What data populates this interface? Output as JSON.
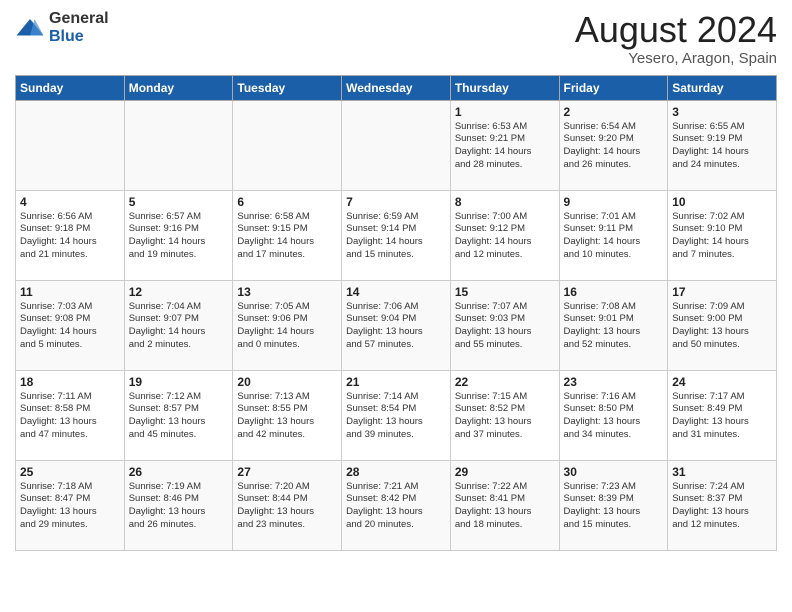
{
  "logo": {
    "general": "General",
    "blue": "Blue"
  },
  "title": "August 2024",
  "subtitle": "Yesero, Aragon, Spain",
  "days_of_week": [
    "Sunday",
    "Monday",
    "Tuesday",
    "Wednesday",
    "Thursday",
    "Friday",
    "Saturday"
  ],
  "weeks": [
    [
      {
        "day": "",
        "info": ""
      },
      {
        "day": "",
        "info": ""
      },
      {
        "day": "",
        "info": ""
      },
      {
        "day": "",
        "info": ""
      },
      {
        "day": "1",
        "info": "Sunrise: 6:53 AM\nSunset: 9:21 PM\nDaylight: 14 hours\nand 28 minutes."
      },
      {
        "day": "2",
        "info": "Sunrise: 6:54 AM\nSunset: 9:20 PM\nDaylight: 14 hours\nand 26 minutes."
      },
      {
        "day": "3",
        "info": "Sunrise: 6:55 AM\nSunset: 9:19 PM\nDaylight: 14 hours\nand 24 minutes."
      }
    ],
    [
      {
        "day": "4",
        "info": "Sunrise: 6:56 AM\nSunset: 9:18 PM\nDaylight: 14 hours\nand 21 minutes."
      },
      {
        "day": "5",
        "info": "Sunrise: 6:57 AM\nSunset: 9:16 PM\nDaylight: 14 hours\nand 19 minutes."
      },
      {
        "day": "6",
        "info": "Sunrise: 6:58 AM\nSunset: 9:15 PM\nDaylight: 14 hours\nand 17 minutes."
      },
      {
        "day": "7",
        "info": "Sunrise: 6:59 AM\nSunset: 9:14 PM\nDaylight: 14 hours\nand 15 minutes."
      },
      {
        "day": "8",
        "info": "Sunrise: 7:00 AM\nSunset: 9:12 PM\nDaylight: 14 hours\nand 12 minutes."
      },
      {
        "day": "9",
        "info": "Sunrise: 7:01 AM\nSunset: 9:11 PM\nDaylight: 14 hours\nand 10 minutes."
      },
      {
        "day": "10",
        "info": "Sunrise: 7:02 AM\nSunset: 9:10 PM\nDaylight: 14 hours\nand 7 minutes."
      }
    ],
    [
      {
        "day": "11",
        "info": "Sunrise: 7:03 AM\nSunset: 9:08 PM\nDaylight: 14 hours\nand 5 minutes."
      },
      {
        "day": "12",
        "info": "Sunrise: 7:04 AM\nSunset: 9:07 PM\nDaylight: 14 hours\nand 2 minutes."
      },
      {
        "day": "13",
        "info": "Sunrise: 7:05 AM\nSunset: 9:06 PM\nDaylight: 14 hours\nand 0 minutes."
      },
      {
        "day": "14",
        "info": "Sunrise: 7:06 AM\nSunset: 9:04 PM\nDaylight: 13 hours\nand 57 minutes."
      },
      {
        "day": "15",
        "info": "Sunrise: 7:07 AM\nSunset: 9:03 PM\nDaylight: 13 hours\nand 55 minutes."
      },
      {
        "day": "16",
        "info": "Sunrise: 7:08 AM\nSunset: 9:01 PM\nDaylight: 13 hours\nand 52 minutes."
      },
      {
        "day": "17",
        "info": "Sunrise: 7:09 AM\nSunset: 9:00 PM\nDaylight: 13 hours\nand 50 minutes."
      }
    ],
    [
      {
        "day": "18",
        "info": "Sunrise: 7:11 AM\nSunset: 8:58 PM\nDaylight: 13 hours\nand 47 minutes."
      },
      {
        "day": "19",
        "info": "Sunrise: 7:12 AM\nSunset: 8:57 PM\nDaylight: 13 hours\nand 45 minutes."
      },
      {
        "day": "20",
        "info": "Sunrise: 7:13 AM\nSunset: 8:55 PM\nDaylight: 13 hours\nand 42 minutes."
      },
      {
        "day": "21",
        "info": "Sunrise: 7:14 AM\nSunset: 8:54 PM\nDaylight: 13 hours\nand 39 minutes."
      },
      {
        "day": "22",
        "info": "Sunrise: 7:15 AM\nSunset: 8:52 PM\nDaylight: 13 hours\nand 37 minutes."
      },
      {
        "day": "23",
        "info": "Sunrise: 7:16 AM\nSunset: 8:50 PM\nDaylight: 13 hours\nand 34 minutes."
      },
      {
        "day": "24",
        "info": "Sunrise: 7:17 AM\nSunset: 8:49 PM\nDaylight: 13 hours\nand 31 minutes."
      }
    ],
    [
      {
        "day": "25",
        "info": "Sunrise: 7:18 AM\nSunset: 8:47 PM\nDaylight: 13 hours\nand 29 minutes."
      },
      {
        "day": "26",
        "info": "Sunrise: 7:19 AM\nSunset: 8:46 PM\nDaylight: 13 hours\nand 26 minutes."
      },
      {
        "day": "27",
        "info": "Sunrise: 7:20 AM\nSunset: 8:44 PM\nDaylight: 13 hours\nand 23 minutes."
      },
      {
        "day": "28",
        "info": "Sunrise: 7:21 AM\nSunset: 8:42 PM\nDaylight: 13 hours\nand 20 minutes."
      },
      {
        "day": "29",
        "info": "Sunrise: 7:22 AM\nSunset: 8:41 PM\nDaylight: 13 hours\nand 18 minutes."
      },
      {
        "day": "30",
        "info": "Sunrise: 7:23 AM\nSunset: 8:39 PM\nDaylight: 13 hours\nand 15 minutes."
      },
      {
        "day": "31",
        "info": "Sunrise: 7:24 AM\nSunset: 8:37 PM\nDaylight: 13 hours\nand 12 minutes."
      }
    ]
  ]
}
